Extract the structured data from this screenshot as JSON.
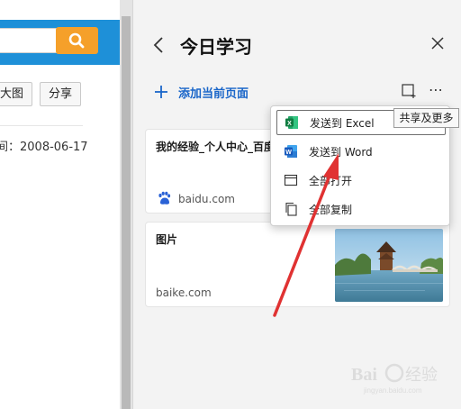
{
  "left_page": {
    "big_image_label": "大图",
    "share_label": "分享",
    "date_text": "间：2008-06-17"
  },
  "panel": {
    "title": "今日学习",
    "add_page_label": "添加当前页面"
  },
  "cards": [
    {
      "title": "我的经验_个人中心_百度",
      "source": "baidu.com"
    },
    {
      "title": "图片",
      "source": "baike.com"
    }
  ],
  "menu": {
    "items": [
      {
        "label": "发送到 Excel",
        "icon": "excel-icon"
      },
      {
        "label": "发送到 Word",
        "icon": "word-icon"
      },
      {
        "label": "全部打开",
        "icon": "window-icon"
      },
      {
        "label": "全部复制",
        "icon": "copy-icon"
      }
    ]
  },
  "tooltip": {
    "text": "共享及更多"
  },
  "watermark": {
    "text": "Baidu 经验"
  },
  "colors": {
    "accent_blue": "#1a66c9",
    "header_blue": "#1e90d8",
    "search_orange": "#f5a02a",
    "arrow_red": "#e03232"
  }
}
